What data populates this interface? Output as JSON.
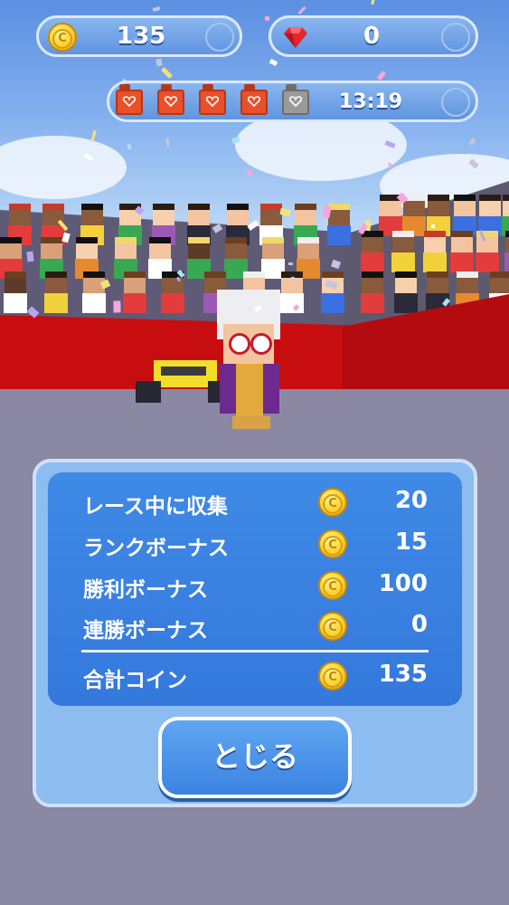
{
  "hud": {
    "coins": "135",
    "gems": "0",
    "fuel_full": 4,
    "fuel_total": 5,
    "timer": "13:19"
  },
  "results": {
    "rows": [
      {
        "label": "レース中に収集",
        "value": "20"
      },
      {
        "label": "ランクボーナス",
        "value": "15"
      },
      {
        "label": "勝利ボーナス",
        "value": "100"
      },
      {
        "label": "連勝ボーナス",
        "value": "0"
      }
    ],
    "total": {
      "label": "合計コイン",
      "value": "135"
    },
    "close_label": "とじる"
  },
  "icons": {
    "coin": "coin-icon",
    "gem": "gem-icon",
    "fuel": "fuel-can-icon"
  },
  "colors": {
    "panel_blue": "#3f8ae6",
    "coin_gold": "#ffd93a",
    "fuel_full": "#e8512a",
    "fuel_empty": "#9a9a9a"
  }
}
